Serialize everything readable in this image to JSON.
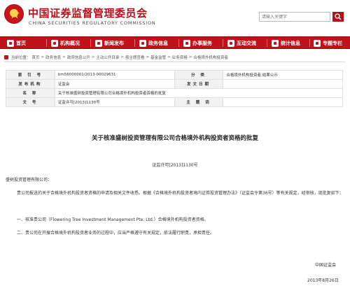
{
  "header": {
    "site_title": "中国证券监督管理委员会",
    "site_subtitle": "CHINA SECURITIES REGULATORY COMMISSION",
    "search_placeholder": "请输入关键字",
    "emblem_icon": "national-emblem-icon",
    "brand_color": "#c0121b"
  },
  "nav": {
    "items": [
      {
        "label": "首页",
        "icon": "home-icon"
      },
      {
        "label": "机构概况",
        "icon": "building-icon"
      },
      {
        "label": "新闻发布",
        "icon": "news-icon"
      },
      {
        "label": "政务信息",
        "icon": "document-icon"
      },
      {
        "label": "办事服务",
        "icon": "service-icon"
      },
      {
        "label": "互动交流",
        "icon": "chat-icon"
      },
      {
        "label": "统计信息",
        "icon": "stats-icon"
      },
      {
        "label": "专题专栏",
        "icon": "topic-icon"
      }
    ]
  },
  "breadcrumb": {
    "prefix": "当前位置：",
    "items": [
      "首页",
      "政务信息",
      "政府信息公开",
      "主动公开目录",
      "按主题查看",
      "基金监管",
      "业务资格",
      "合格境外机构投资者"
    ],
    "separator": ">"
  },
  "info": {
    "index_label": "索 引 号",
    "index_value": "bm56000001/2013-00029631",
    "category_label": "分 类",
    "category_value": "合格境外机构投资者;结果公示",
    "issuer_label": "发布机构",
    "issuer_value": "证监会",
    "date_label": "发文日期",
    "date_value": "",
    "name_label": "名 称",
    "name_value": "关于核准盛树投资管理有限公司合格境外机构投资者资格的批复",
    "doc_label": "文 号",
    "doc_value": "证监许可[2013]1130号",
    "keyword_label": "主 题 词",
    "keyword_value": ""
  },
  "article": {
    "title": "关于核准盛树投资管理有限公司合格境外机构投资者资格的批复",
    "number": "证监许可[2013]1130号",
    "salutation": "盛树投资管理有限公司：",
    "para1": "贵公司报送的关于合格境外机构投资者资格的申请及相关文件收悉。根据《合格境外机构投资者境内证券投资管理办法》（证监会令第36号）等有关规定，经审核，现批复如下：",
    "para2": "一、核准贵公司（Flowering Tree Investment Management Pte. Ltd.）合格境外机构投资者资格。",
    "para3": "二、贵公司在开展合格境外机构投资者业务的过程中，应当严格遵守有关规定，依法履行职责，承担责任。",
    "sign_org": "中国证监会",
    "sign_date": "2013年8月26日"
  }
}
